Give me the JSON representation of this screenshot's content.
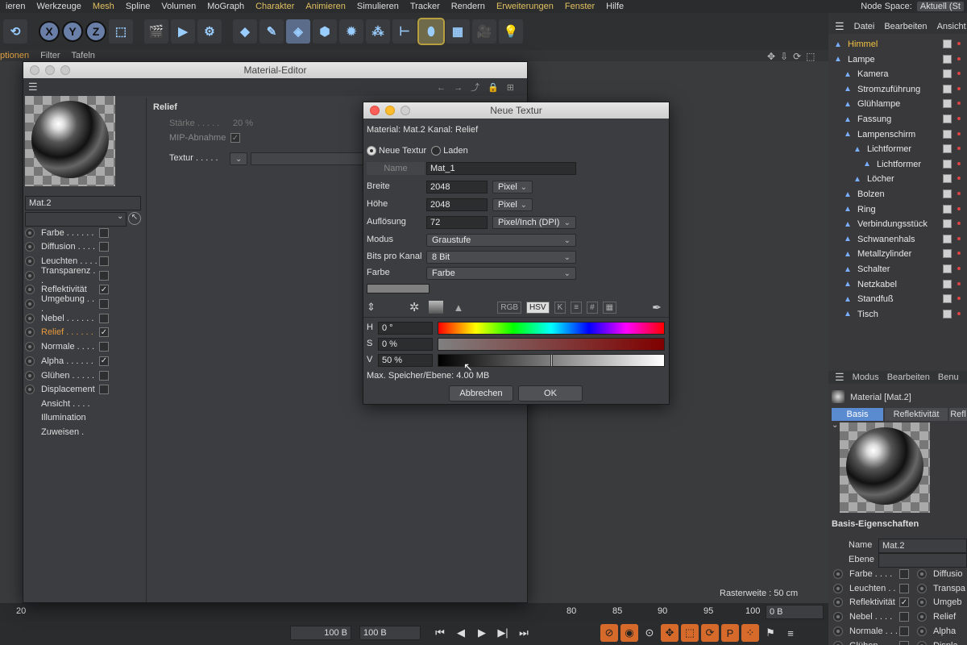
{
  "menu": {
    "items": [
      "ieren",
      "Werkzeuge",
      "Mesh",
      "Spline",
      "Volumen",
      "MoGraph",
      "Charakter",
      "Animieren",
      "Simulieren",
      "Tracker",
      "Rendern",
      "Erweiterungen",
      "Fenster",
      "Hilfe"
    ],
    "node_space_label": "Node Space:",
    "node_space_value": "Aktuell (St"
  },
  "submenu": [
    "ptionen",
    "Filter",
    "Tafeln"
  ],
  "viewport": {
    "raster": "Rasterweite : 50 cm"
  },
  "timeline": {
    "left": "20",
    "ticks": [
      "80",
      "85",
      "90",
      "95",
      "100"
    ],
    "right": "0 B"
  },
  "transport": {
    "field1": "100 B",
    "field2": "100 B"
  },
  "material_editor": {
    "title": "Material-Editor",
    "section": "Relief",
    "staerke_label": "Stärke . . . . .",
    "staerke_value": "20 %",
    "mip_label": "MIP-Abnahme",
    "textur_label": "Textur . . . . .",
    "mat_name": "Mat.2",
    "channels": [
      {
        "label": "Farbe . . . . . .",
        "checked": false
      },
      {
        "label": "Diffusion . . . .",
        "checked": false
      },
      {
        "label": "Leuchten . . . .",
        "checked": false
      },
      {
        "label": "Transparenz . .",
        "checked": false
      },
      {
        "label": "Reflektivität",
        "checked": true
      },
      {
        "label": "Umgebung . . .",
        "checked": false
      },
      {
        "label": "Nebel . . . . . .",
        "checked": false
      },
      {
        "label": "Relief . . . . . .",
        "checked": true,
        "active": true
      },
      {
        "label": "Normale . . . .",
        "checked": false
      },
      {
        "label": "Alpha . . . . . .",
        "checked": true
      },
      {
        "label": "Glühen . . . . .",
        "checked": false
      },
      {
        "label": "Displacement",
        "checked": false
      }
    ],
    "extra": [
      "Ansicht . . . .",
      "Illumination",
      "Zuweisen ."
    ]
  },
  "dialog": {
    "title": "Neue Textur",
    "info": "Material: Mat.2 Kanal: Relief",
    "opt_new": "Neue Textur",
    "opt_load": "Laden",
    "name_label": "Name",
    "name_value": "Mat_1",
    "breite_label": "Breite",
    "breite_value": "2048",
    "breite_unit": "Pixel",
    "hoehe_label": "Höhe",
    "hoehe_value": "2048",
    "hoehe_unit": "Pixel",
    "aufl_label": "Auflösung",
    "aufl_value": "72",
    "aufl_unit": "Pixel/Inch (DPI)",
    "modus_label": "Modus",
    "modus_value": "Graustufe",
    "bits_label": "Bits pro Kanal",
    "bits_value": "8 Bit",
    "farbe_label": "Farbe",
    "farbe_value": "Farbe",
    "picker_modes": [
      "RGB",
      "HSV",
      "K",
      "≡",
      "#",
      "▦"
    ],
    "h_label": "H",
    "h_value": "0 °",
    "s_label": "S",
    "s_value": "0 %",
    "v_label": "V",
    "v_value": "50 %",
    "v_level": 0.5,
    "memory": "Max. Speicher/Ebene: 4.00 MB",
    "cancel": "Abbrechen",
    "ok": "OK"
  },
  "object_manager": {
    "menu": [
      "Datei",
      "Bearbeiten",
      "Ansicht"
    ],
    "objects": [
      {
        "name": "Himmel",
        "indent": 0,
        "color": "#f0c040"
      },
      {
        "name": "Lampe",
        "indent": 0
      },
      {
        "name": "Kamera",
        "indent": 1
      },
      {
        "name": "Stromzuführung",
        "indent": 1
      },
      {
        "name": "Glühlampe",
        "indent": 1
      },
      {
        "name": "Fassung",
        "indent": 1
      },
      {
        "name": "Lampenschirm",
        "indent": 1
      },
      {
        "name": "Lichtformer",
        "indent": 2
      },
      {
        "name": "Lichtformer",
        "indent": 3
      },
      {
        "name": "Löcher",
        "indent": 2
      },
      {
        "name": "Bolzen",
        "indent": 1
      },
      {
        "name": "Ring",
        "indent": 1
      },
      {
        "name": "Verbindungsstück",
        "indent": 1
      },
      {
        "name": "Schwanenhals",
        "indent": 1
      },
      {
        "name": "Metallzylinder",
        "indent": 1
      },
      {
        "name": "Schalter",
        "indent": 1
      },
      {
        "name": "Netzkabel",
        "indent": 1
      },
      {
        "name": "Standfuß",
        "indent": 1
      },
      {
        "name": "Tisch",
        "indent": 1
      }
    ]
  },
  "attribute_manager": {
    "menu": [
      "Modus",
      "Bearbeiten",
      "Benu"
    ],
    "title": "Material [Mat.2]",
    "tabs": [
      "Basis",
      "Reflektivität",
      "Refl"
    ],
    "section": "Basis-Eigenschaften",
    "name_label": "Name",
    "name_value": "Mat.2",
    "ebene_label": "Ebene",
    "props_left": [
      {
        "label": "Farbe . . . .",
        "checked": false
      },
      {
        "label": "Leuchten . .",
        "checked": false
      },
      {
        "label": "Reflektivität",
        "checked": true
      },
      {
        "label": "Nebel . . . .",
        "checked": false
      },
      {
        "label": "Normale . . .",
        "checked": false
      },
      {
        "label": "Glühen . . .",
        "checked": false
      }
    ],
    "props_right": [
      "Diffusio",
      "Transpa",
      "Umgeb",
      "Relief",
      "Alpha",
      "Displa"
    ]
  }
}
